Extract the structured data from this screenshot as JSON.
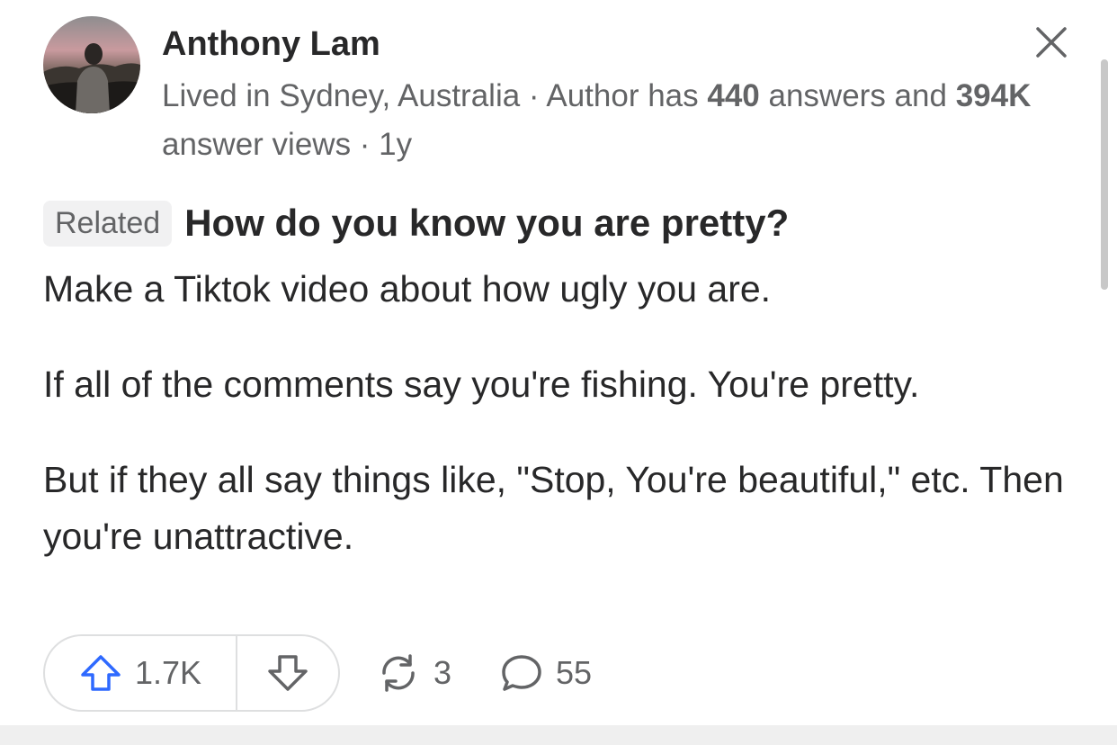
{
  "author": {
    "name": "Anthony Lam",
    "meta_prefix": "Lived in Sydney, Australia · Author has ",
    "answers_count": "440",
    "meta_mid": " answers and ",
    "views_count": "394K",
    "meta_suffix": " answer views · 1y"
  },
  "related": {
    "badge": "Related",
    "question": "How do you know you are pretty?"
  },
  "answer": {
    "paragraphs": [
      "Make a Tiktok video about how ugly you are.",
      "If all of the comments say you're fishing. You're pretty.",
      "But if they all say things like, \"Stop, You're beautiful,\" etc. Then you're unattractive."
    ]
  },
  "actions": {
    "upvotes": "1.7K",
    "shares": "3",
    "comments": "55"
  },
  "icons": {
    "close": "close-icon",
    "upvote": "arrow-up-icon",
    "downvote": "arrow-down-icon",
    "share": "reshare-icon",
    "comment": "comment-icon"
  },
  "colors": {
    "upvote_accent": "#2e69ff",
    "text_primary": "#282829",
    "text_secondary": "#636466",
    "border": "#dedfe0"
  }
}
